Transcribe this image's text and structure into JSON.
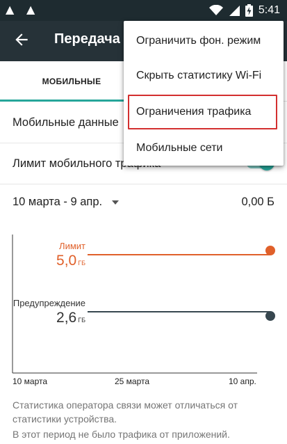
{
  "status_bar": {
    "time": "5:41",
    "icons": [
      "warning-icon",
      "warning-icon",
      "wifi-icon",
      "signal-icon",
      "battery-charging-icon"
    ]
  },
  "app_bar": {
    "title": "Передача"
  },
  "tabs": {
    "mobile": "МОБИЛЬНЫЕ"
  },
  "settings": {
    "mobile_data": "Мобильные данные",
    "mobile_limit": "Лимит мобильного трафика",
    "mobile_limit_enabled": true,
    "cycle": "10 марта - 9 апр.",
    "usage": "0,00 Б"
  },
  "chart_data": {
    "type": "line",
    "x_ticks": [
      "10 марта",
      "25 марта",
      "10 апр."
    ],
    "limit": {
      "label": "Лимит",
      "value": "5,0",
      "unit": "ГБ",
      "color": "#e0602a"
    },
    "warning": {
      "label": "Предупреждение",
      "value": "2,6",
      "unit": "ГБ",
      "color": "#37474f"
    },
    "usage_series": []
  },
  "notes": {
    "line_1": "Статистика оператора связи может отличаться от статистики устройства.",
    "line_2": "В этот период не было трафика от приложений."
  },
  "menu": {
    "items": [
      "Ограничить фон. режим",
      "Скрыть статистику Wi-Fi",
      "Ограничения трафика",
      "Мобильные сети"
    ],
    "highlighted_index": 2,
    "highlight_color": "#d32f2f"
  },
  "colors": {
    "status_bar": "#1e2b30",
    "app_bar": "#263238",
    "accent": "#26a69a",
    "limit": "#e0602a",
    "warning": "#37474f"
  }
}
